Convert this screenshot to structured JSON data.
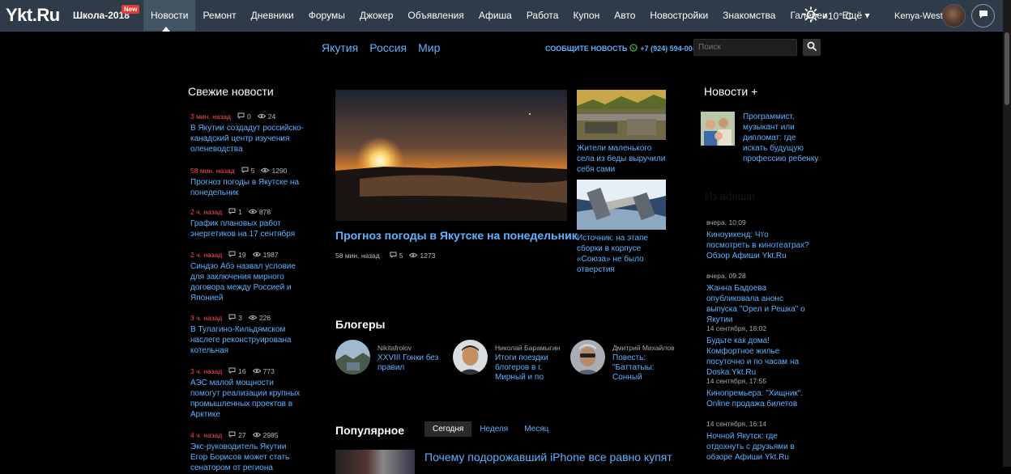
{
  "topbar": {
    "logo": "Ykt.Ru",
    "school": "Школа-2018",
    "new_badge": "New",
    "nav": [
      "Новости",
      "Ремонт",
      "Дневники",
      "Форумы",
      "Джокер",
      "Объявления",
      "Афиша",
      "Работа",
      "Купон",
      "Авто",
      "Новостройки",
      "Знакомства",
      "Галереи",
      "Ещё ▾"
    ],
    "weather": "+10° С",
    "username": "Kenya-West"
  },
  "subnav": {
    "links": [
      "Якутия",
      "Россия",
      "Мир"
    ],
    "report_label": "СООБЩИТЕ НОВОСТЬ",
    "report_phone": "+7 (924) 594-00-70",
    "search_placeholder": "Поиск"
  },
  "fresh_news": {
    "title": "Свежие новости",
    "items": [
      {
        "time": "3 мин. назад",
        "comments": "0",
        "views": "24",
        "text": "В Якутии создадут российско-канадский центр изучения оленеводства"
      },
      {
        "time": "58 мин. назад",
        "comments": "5",
        "views": "1290",
        "text": "Прогноз погоды в Якутске на понедельник"
      },
      {
        "time": "2 ч. назад",
        "comments": "1",
        "views": "878",
        "text": "График плановых работ энергетиков на 17 сентября"
      },
      {
        "time": "2 ч. назад",
        "comments": "19",
        "views": "1987",
        "text": "Синдзо Абэ назвал условие для заключения мирного договора между Россией и Японией"
      },
      {
        "time": "3 ч. назад",
        "comments": "3",
        "views": "226",
        "text": "В Тулагино-Кильдямском наслеге реконструирована котельная"
      },
      {
        "time": "3 ч. назад",
        "comments": "16",
        "views": "773",
        "text": "АЭС малой мощности помогут реализации крупных промышленных проектов в Арктике"
      },
      {
        "time": "4 ч. назад",
        "comments": "27",
        "views": "2985",
        "text": "Экс-руководитель Якутии Егор Борисов может стать сенатором от региона"
      }
    ]
  },
  "main_news": {
    "title": "Прогноз погоды в Якутске на понедельник",
    "time": "58 мин. назад",
    "comments": "5",
    "views": "1273"
  },
  "side_news": [
    {
      "text": "Жители маленького села из беды выручили себя сами"
    },
    {
      "text": "Источник: на этапе сборки в корпусе «Союза» не было отверстия"
    }
  ],
  "bloggers": {
    "title": "Блогеры",
    "items": [
      {
        "name": "Nikitafrolov",
        "post": "XXVIII Гонки без правил"
      },
      {
        "name": "Николай Барамыгин",
        "post": "Итоги поездки блогеров в г. Мирный и по"
      },
      {
        "name": "Дмитрий Михайлов",
        "post": "Повесть: \"Баттатыы: Сонный"
      }
    ]
  },
  "popular": {
    "title": "Популярное",
    "tabs": [
      "Сегодня",
      "Неделя",
      "Месяц"
    ],
    "headline": "Почему подорожавший iPhone все равно купят"
  },
  "news_plus": {
    "title": "Новости +",
    "text": "Программист, музыкант или дипломат: где искать будущую профессию ребенку"
  },
  "right_list": {
    "heading": "Из афиши",
    "items": [
      {
        "time": "вчера, 10:09",
        "text": "Киноуикенд: Что посмотреть в кинотеатрах? Обзор Афиши Ykt.Ru"
      },
      {
        "time": "вчера, 09:28",
        "text": "Жанна Бадоева опубликовала анонс выпуска \"Орел и Решка\" о Якутии"
      },
      {
        "time": "14 сентября, 18:02",
        "text": "Будьте как дома! Комфортное жилье посуточно и по часам на Doska.Ykt.Ru"
      },
      {
        "time": "14 сентября, 17:55",
        "text": "Кинопремьера: \"Хищник\". Online продажа билетов"
      },
      {
        "time": "14 сентября, 16:14",
        "text": "Ночной Якутск: где отдохнуть с друзьями в обзоре Афиши Ykt.Ru"
      }
    ]
  },
  "colors": {
    "topbar": "#2f3b48",
    "link": "#5fb1ff",
    "time_red": "#ff4c4c",
    "background": "#000000"
  }
}
